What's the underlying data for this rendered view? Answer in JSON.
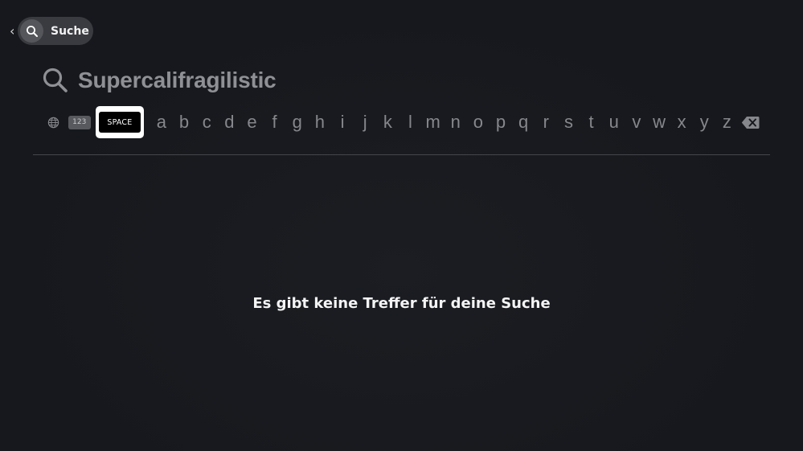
{
  "header": {
    "back_glyph": "‹",
    "search_pill_label": "Suche",
    "search_pill_icon": "search-icon"
  },
  "search": {
    "query": "Supercalifragilistic",
    "icon": "search-icon"
  },
  "keyboard": {
    "globe_icon": "globe-icon",
    "numbers_label": "123",
    "space_label": "SPACE",
    "letters": [
      "a",
      "b",
      "c",
      "d",
      "e",
      "f",
      "g",
      "h",
      "i",
      "j",
      "k",
      "l",
      "m",
      "n",
      "o",
      "p",
      "q",
      "r",
      "s",
      "t",
      "u",
      "v",
      "w",
      "x",
      "y",
      "z"
    ],
    "backspace_icon": "backspace-icon"
  },
  "results": {
    "empty_message": "Es gibt keine Treffer für deine Suche"
  },
  "colors": {
    "background": "#16181d",
    "focus": "#ffffff",
    "query_text": "#8f9096",
    "letter_text": "#86878c"
  }
}
